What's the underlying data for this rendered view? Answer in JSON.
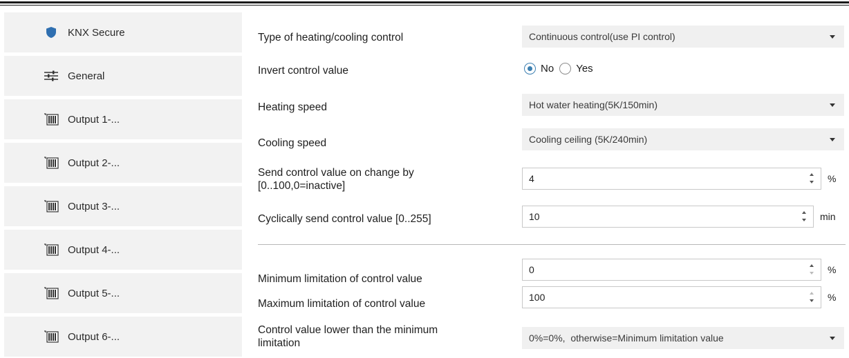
{
  "sidebar": {
    "items": [
      {
        "label": "KNX Secure",
        "icon": "shield-icon"
      },
      {
        "label": "General",
        "icon": "sliders-icon"
      },
      {
        "label": "Output 1-...",
        "icon": "actuator-icon"
      },
      {
        "label": "Output 2-...",
        "icon": "actuator-icon"
      },
      {
        "label": "Output 3-...",
        "icon": "actuator-icon"
      },
      {
        "label": "Output 4-...",
        "icon": "actuator-icon"
      },
      {
        "label": "Output 5-...",
        "icon": "actuator-icon"
      },
      {
        "label": "Output 6-...",
        "icon": "actuator-icon"
      }
    ]
  },
  "params": {
    "control_type": {
      "label": "Type of heating/cooling control",
      "value": "Continuous control(use PI control)"
    },
    "invert": {
      "label": "Invert control value",
      "options": [
        "No",
        "Yes"
      ],
      "selected": "No"
    },
    "heating_speed": {
      "label": "Heating speed",
      "value": "Hot water heating(5K/150min)"
    },
    "cooling_speed": {
      "label": "Cooling speed",
      "value": "Cooling ceiling (5K/240min)"
    },
    "send_on_change": {
      "label_line1": "Send control value on change by",
      "label_line2": "[0..100,0=inactive]",
      "value": "4",
      "unit": "%"
    },
    "cyclic_send": {
      "label": "Cyclically send control value [0..255]",
      "value": "10",
      "unit": "min"
    },
    "min_limit": {
      "label": "Minimum limitation of control value",
      "value": "0",
      "unit": "%"
    },
    "max_limit": {
      "label": "Maximum limitation of control value",
      "value": "100",
      "unit": "%"
    },
    "lower_than_min": {
      "label_line1": "Control value lower than the minimum",
      "label_line2": "limitation",
      "value": "0%=0%,  otherwise=Minimum limitation value"
    }
  },
  "colors": {
    "accent": "#3c7fb1",
    "shield": "#2f6fb0",
    "sidebar_bg": "#f2f2f2",
    "dropdown_bg": "#f0f0f0"
  }
}
